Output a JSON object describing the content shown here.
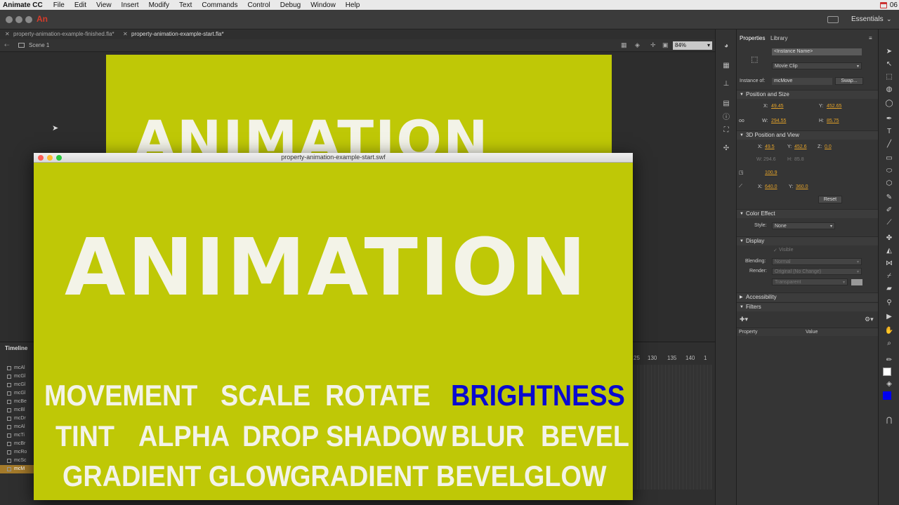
{
  "menubar": {
    "app": "Animate CC",
    "items": [
      "File",
      "Edit",
      "View",
      "Insert",
      "Modify",
      "Text",
      "Commands",
      "Control",
      "Debug",
      "Window",
      "Help"
    ],
    "clock": "06"
  },
  "appbar": {
    "logo": "An",
    "workspace": "Essentials"
  },
  "doc_tabs": [
    "property-animation-example-finished.fla*",
    "property-animation-example-start.fla*"
  ],
  "scene": {
    "name": "Scene 1",
    "zoom": "84%"
  },
  "stage": {
    "headline": "ANIMATION",
    "background": "#bfc806"
  },
  "swf_window": {
    "title": "property-animation-example-start.swf",
    "headline": "ANIMATION",
    "options": [
      "MOVEMENT",
      "SCALE",
      "ROTATE",
      "BRIGHTNESS",
      "TINT",
      "ALPHA",
      "DROP SHADOW",
      "BLUR",
      "BEVEL",
      "GRADIENT GLOW",
      "GRADIENT BEVEL",
      "GLOW"
    ],
    "active_option": "BRIGHTNESS",
    "active_color": "#0a0ad0"
  },
  "timeline": {
    "title": "Timeline",
    "layers": [
      "mcAl",
      "mcGl",
      "mcGl",
      "mcGl",
      "mcBe",
      "mcBl",
      "mcDr",
      "mcAl",
      "mcTi",
      "mcBr",
      "mcRo",
      "mcSc",
      "mcM"
    ],
    "selected_layer": "mcM",
    "ruler": [
      "25",
      "130",
      "135",
      "140",
      "1"
    ]
  },
  "properties": {
    "tabs": [
      "Properties",
      "Library"
    ],
    "instance_name_placeholder": "<Instance Name>",
    "symbol_type": "Movie Clip",
    "instance_of_label": "Instance of:",
    "instance_of": "mcMove",
    "swap": "Swap...",
    "position_size": {
      "title": "Position and Size",
      "x_label": "X:",
      "x": "49.45",
      "y_label": "Y:",
      "y": "452.65",
      "w_label": "W:",
      "w": "294.55",
      "h_label": "H:",
      "h": "85.75"
    },
    "position_3d": {
      "title": "3D Position and View",
      "x_label": "X:",
      "x": "49.5",
      "y_label": "Y:",
      "y": "452.6",
      "z_label": "Z:",
      "z": "0.0",
      "w_label": "W:",
      "w": "294.6",
      "h_label": "H:",
      "h": "85.8",
      "perspective": "100.9",
      "vx_label": "X:",
      "vx": "640.0",
      "vy_label": "Y:",
      "vy": "360.0",
      "reset": "Reset"
    },
    "color_effect": {
      "title": "Color Effect",
      "style_label": "Style:",
      "style": "None"
    },
    "display": {
      "title": "Display",
      "visible": "Visible",
      "blending_label": "Blending:",
      "blending": "Normal",
      "render_label": "Render:",
      "render": "Original (No Change)",
      "transparent": "Transparent"
    },
    "accessibility": "Accessibility",
    "filters": {
      "title": "Filters",
      "col_property": "Property",
      "col_value": "Value"
    }
  }
}
